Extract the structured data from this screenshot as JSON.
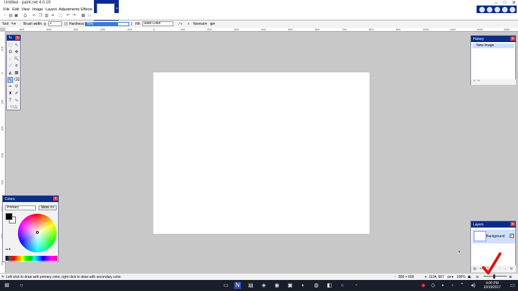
{
  "window": {
    "title": "Untitled - paint.net 4.0.19"
  },
  "menu": [
    "File",
    "Edit",
    "View",
    "Image",
    "Layers",
    "Adjustments",
    "Effects"
  ],
  "toolbar": {
    "tool_label": "Tool:",
    "brush_width_label": "Brush width:",
    "brush_width_value": "2",
    "hardness_label": "Hardness:",
    "hardness_value": "75%",
    "hardness_level": 0.75,
    "fill_label": "Fill:",
    "fill_value": "Solid Color",
    "blend_value": "Normal"
  },
  "ruler": {
    "top_ticks": [
      "-500",
      "-400",
      "-300",
      "-200",
      "-100",
      "0",
      "100",
      "200",
      "300",
      "400",
      "500",
      "600",
      "700",
      "800",
      "900",
      "1000",
      "1100",
      "1200",
      "1300"
    ],
    "left_ticks": [
      "-100",
      "0",
      "100",
      "200",
      "300",
      "400",
      "500",
      "600",
      "700"
    ]
  },
  "tools_window": {
    "title": "To"
  },
  "colors_window": {
    "title": "Colors",
    "primary_select": "Primary",
    "more_button": "More >>"
  },
  "history_window": {
    "title": "History",
    "item": "New Image"
  },
  "layers_window": {
    "title": "Layers",
    "layer_name": "Background"
  },
  "status": {
    "hint": "Left click to draw with primary color, right click to draw with secondary color.",
    "size": "800 × 600",
    "position": "1134, 667",
    "units": "px",
    "zoom": "100%"
  },
  "taskbar": {
    "time": "4:00 PM",
    "date": "10/19/2017"
  },
  "colors": {
    "accent": "#0b2c8b",
    "primary": "#000000",
    "secondary": "#ffffff",
    "annotation": "#e01010"
  }
}
